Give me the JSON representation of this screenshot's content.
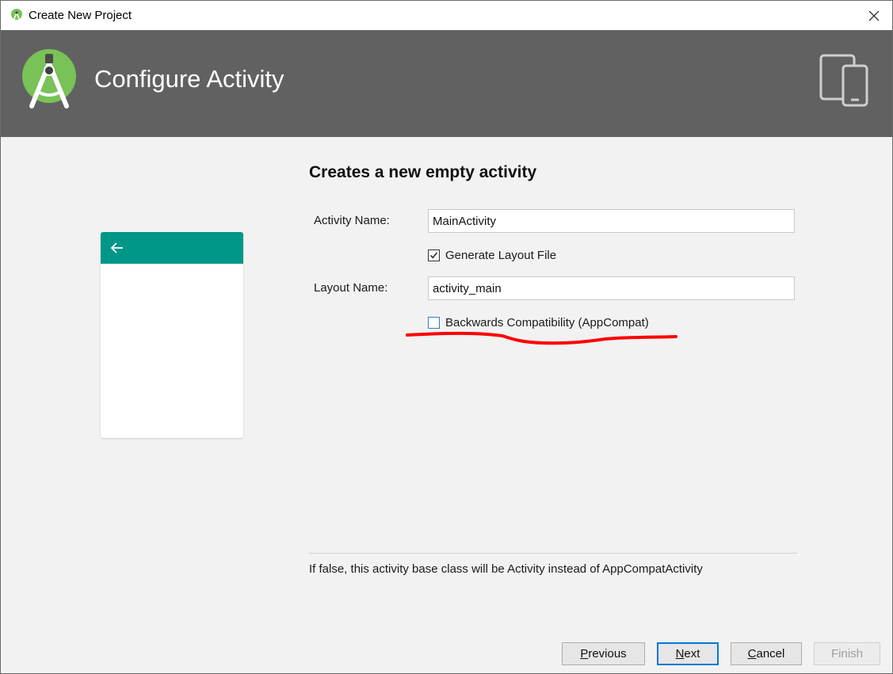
{
  "window": {
    "title": "Create New Project",
    "header_title": "Configure Activity"
  },
  "form": {
    "title": "Creates a new empty activity",
    "activity_name_label": "Activity Name:",
    "activity_name_value": "MainActivity",
    "generate_layout_label": "Generate Layout File",
    "generate_layout_checked": true,
    "layout_name_label": "Layout Name:",
    "layout_name_value": "activity_main",
    "backwards_compat_label": "Backwards Compatibility (AppCompat)",
    "backwards_compat_checked": false
  },
  "help": {
    "text": "If false, this activity base class will be Activity instead of AppCompatActivity"
  },
  "buttons": {
    "previous": {
      "mnemonic": "P",
      "rest": "revious"
    },
    "next": {
      "mnemonic": "N",
      "rest": "ext"
    },
    "cancel": {
      "mnemonic": "C",
      "rest": "ancel"
    },
    "finish": "Finish"
  },
  "colors": {
    "header_bg": "#616161",
    "preview_appbar": "#009688",
    "android_green": "#78c257",
    "annotation_red": "#ff0000",
    "primary_button_border": "#0078d7"
  },
  "icons": [
    "android-studio-icon",
    "close-icon",
    "android-studio-logo",
    "devices-icon",
    "back-arrow-icon",
    "checkmark-icon"
  ]
}
